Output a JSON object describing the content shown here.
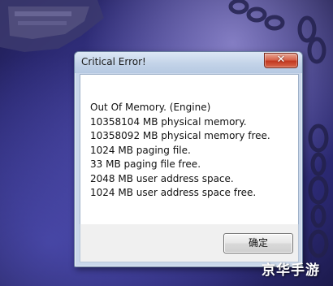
{
  "dialog": {
    "title": "Critical Error!",
    "close_icon": "close-icon",
    "message_lines": [
      "Out Of Memory. (Engine)",
      "10358104 MB physical memory.",
      "10358092 MB physical memory free.",
      "1024 MB paging file.",
      "33 MB paging file free.",
      "2048 MB user address space.",
      "1024 MB user address space free."
    ],
    "ok_label": "确定"
  },
  "watermark": {
    "text": "京华手游"
  },
  "colors": {
    "title_bar": "#c3d3e8",
    "close_button": "#c2381f",
    "content_background": "#ffffff",
    "footer_background": "#f0f0f0",
    "background": "#3a3890"
  }
}
